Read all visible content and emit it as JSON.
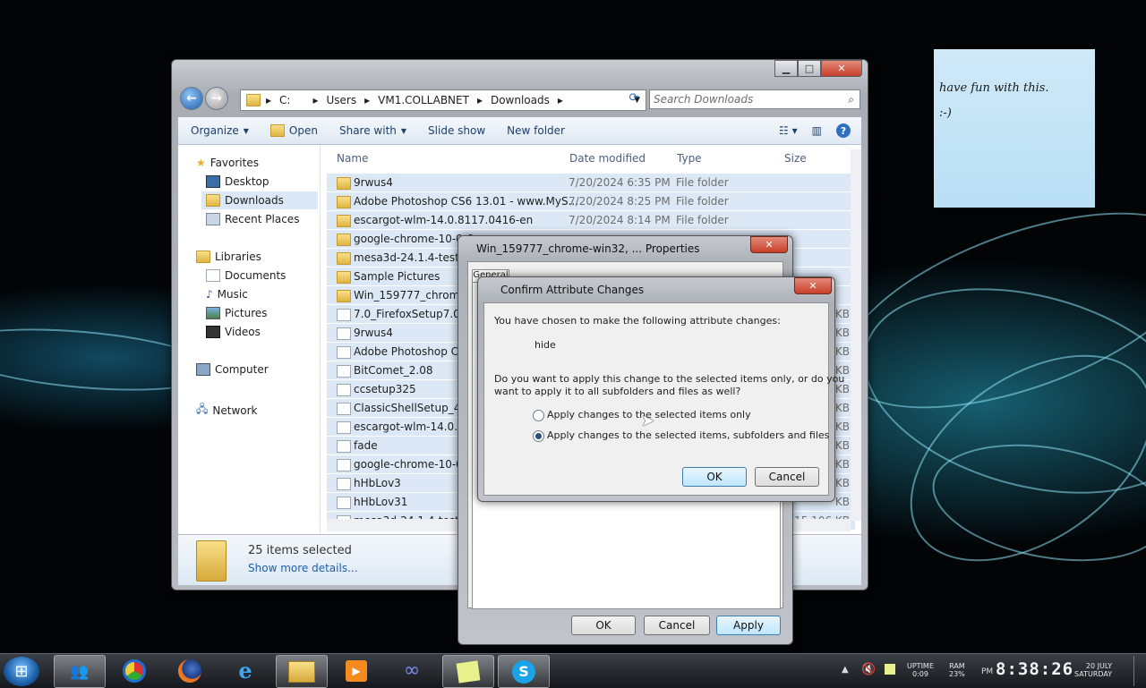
{
  "sticky_note": {
    "line1": "have fun with this.",
    "line2": ":-)"
  },
  "explorer": {
    "address_parts": [
      "C:",
      "Users",
      "VM1.COLLABNET",
      "Downloads"
    ],
    "search_placeholder": "Search Downloads",
    "toolbar": {
      "organize": "Organize",
      "open": "Open",
      "share_with": "Share with",
      "slide_show": "Slide show",
      "new_folder": "New folder"
    },
    "nav": {
      "favorites": "Favorites",
      "desktop": "Desktop",
      "downloads": "Downloads",
      "recent_places": "Recent Places",
      "libraries": "Libraries",
      "documents": "Documents",
      "music": "Music",
      "pictures": "Pictures",
      "videos": "Videos",
      "computer": "Computer",
      "network": "Network"
    },
    "columns": {
      "name": "Name",
      "date": "Date modified",
      "type": "Type",
      "size": "Size"
    },
    "files": [
      {
        "name": "9rwus4",
        "date": "7/20/2024 6:35 PM",
        "type": "File folder",
        "size": ""
      },
      {
        "name": "Adobe Photoshop CS6 13.01 - www.MyS...",
        "date": "7/20/2024 8:25 PM",
        "type": "File folder",
        "size": ""
      },
      {
        "name": "escargot-wlm-14.0.8117.0416-en",
        "date": "7/20/2024 8:14 PM",
        "type": "File folder",
        "size": ""
      },
      {
        "name": "google-chrome-10-0-6",
        "date": "",
        "type": "",
        "size": ""
      },
      {
        "name": "mesa3d-24.1.4-tests-r",
        "date": "",
        "type": "",
        "size": ""
      },
      {
        "name": "Sample Pictures",
        "date": "",
        "type": "",
        "size": ""
      },
      {
        "name": "Win_159777_chrome-",
        "date": "",
        "type": "",
        "size": ""
      },
      {
        "name": "7.0_FirefoxSetup7.0",
        "date": "",
        "type": "",
        "size": "KB"
      },
      {
        "name": "9rwus4",
        "date": "",
        "type": "",
        "size": "KB"
      },
      {
        "name": "Adobe Photoshop CS6",
        "date": "",
        "type": "",
        "size": "KB"
      },
      {
        "name": "BitComet_2.08",
        "date": "",
        "type": "",
        "size": "KB"
      },
      {
        "name": "ccsetup325",
        "date": "",
        "type": "",
        "size": "KB"
      },
      {
        "name": "ClassicShellSetup_4_3_1",
        "date": "",
        "type": "",
        "size": "KB"
      },
      {
        "name": "escargot-wlm-14.0.811",
        "date": "",
        "type": "",
        "size": "KB"
      },
      {
        "name": "fade",
        "date": "",
        "type": "",
        "size": "KB"
      },
      {
        "name": "google-chrome-10-0-6",
        "date": "",
        "type": "",
        "size": "KB"
      },
      {
        "name": "hHbLov3",
        "date": "",
        "type": "",
        "size": "KB"
      },
      {
        "name": "hHbLov31",
        "date": "",
        "type": "",
        "size": "KB"
      },
      {
        "name": "mesa3d-24.1.4-tests-r",
        "date": "",
        "type": "",
        "size": "115,106 KB"
      }
    ],
    "status": {
      "count": "25 items selected",
      "more": "Show more details..."
    }
  },
  "properties": {
    "title": "Win_159777_chrome-win32, ... Properties",
    "tab1": "General",
    "ok": "OK",
    "cancel": "Cancel",
    "apply": "Apply"
  },
  "confirm": {
    "title": "Confirm Attribute Changes",
    "intro": "You have chosen to make the following attribute changes:",
    "change": "hide",
    "question_line1": "Do you want to apply this change to the selected items only, or do you",
    "question_line2": "want to apply it to all subfolders and files as well?",
    "option1": "Apply changes to the selected items only",
    "option2": "Apply changes to the selected items, subfolders and files",
    "selected_option": 2,
    "ok": "OK",
    "cancel": "Cancel"
  },
  "taskbar": {
    "uptime_label": "UPTIME",
    "uptime_value": "0:09",
    "ram_label": "RAM",
    "ram_value": "23%",
    "ampm": "PM",
    "time": "8:38:26",
    "date_line1": "20 JULY",
    "date_line2": "SATURDAY"
  },
  "colors": {
    "selection": "#dce8f6",
    "desktop": "#020406",
    "accent": "#1e3f6a"
  }
}
